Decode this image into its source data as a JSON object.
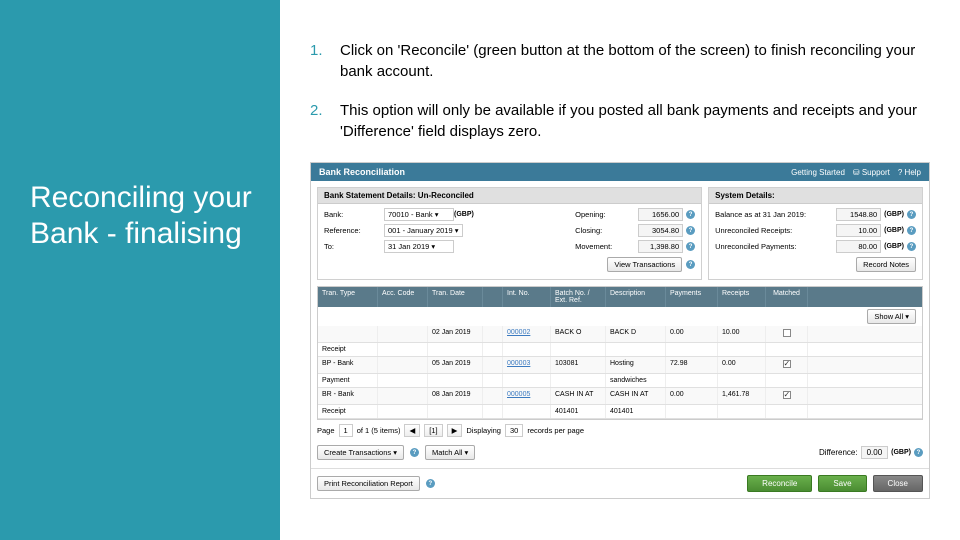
{
  "sidebar_title": "Reconciling your Bank - finalising",
  "steps": [
    "Click on 'Reconcile' (green button at the bottom of the screen) to finish reconciling your bank account.",
    "This option will only be available if you posted all bank payments and receipts and your 'Difference' field displays zero."
  ],
  "app": {
    "header": {
      "title": "Bank Reconciliation",
      "links": [
        "Getting Started",
        "Support",
        "Help"
      ]
    },
    "left_panel": {
      "heading": "Bank Statement Details: Un-Reconciled",
      "bank_label": "Bank:",
      "bank_value": "70010 - Bank",
      "bank_ccy": "(GBP)",
      "opening_label": "Opening:",
      "opening_value": "1656.00",
      "ref_label": "Reference:",
      "ref_value": "001 - January 2019",
      "closing_label": "Closing:",
      "closing_value": "3054.80",
      "to_label": "To:",
      "to_value": "31 Jan 2019",
      "movement_label": "Movement:",
      "movement_value": "1,398.80",
      "view_trans": "View Transactions"
    },
    "right_panel": {
      "heading": "System Details:",
      "balance_label": "Balance as at 31 Jan 2019:",
      "balance_value": "1548.80",
      "unrec_rec_label": "Unreconciled Receipts:",
      "unrec_rec_value": "10.00",
      "unrec_pay_label": "Unreconciled Payments:",
      "unrec_pay_value": "80.00",
      "record_notes": "Record Notes"
    },
    "grid": {
      "headers": [
        "Tran. Type",
        "Acc. Code",
        "Tran. Date",
        "",
        "Int. No.",
        "Batch No. / Ext. Ref.",
        "Description",
        "Payments",
        "Receipts",
        "Matched"
      ],
      "show_all": "Show All",
      "rows": [
        {
          "type": "",
          "code": "",
          "date": "02 Jan 2019",
          "int": "000002",
          "ext": "BACK O",
          "desc": "BACK D",
          "pay": "0.00",
          "rec": "10.00",
          "matched": false
        },
        {
          "type": "Receipt",
          "code": "",
          "date": "",
          "int": "",
          "ext": "",
          "desc": "",
          "pay": "",
          "rec": "",
          "matched": true
        },
        {
          "type": "BP - Bank",
          "code": "",
          "date": "05 Jan 2019",
          "int": "000003",
          "ext": "103081",
          "desc": "Hosting",
          "pay": "72.98",
          "rec": "0.00",
          "matched": true
        },
        {
          "type": "Payment",
          "code": "",
          "date": "",
          "int": "",
          "ext": "",
          "desc": "sandwiches",
          "pay": "",
          "rec": "",
          "matched": false
        },
        {
          "type": "BR - Bank",
          "code": "",
          "date": "08 Jan 2019",
          "int": "000005",
          "ext": "CASH IN AT",
          "desc": "CASH IN AT",
          "pay": "0.00",
          "rec": "1,461.78",
          "matched": true
        },
        {
          "type": "Receipt",
          "code": "",
          "date": "",
          "int": "",
          "ext": "401401",
          "desc": "401401",
          "pay": "",
          "rec": "",
          "matched": false
        }
      ]
    },
    "pager": {
      "page_label": "Page",
      "page": "1",
      "of": "of 1 (5 items)",
      "displaying": "Displaying",
      "per_page": "30",
      "per_page_label": "records per page"
    },
    "actions": {
      "create_trans": "Create Transactions",
      "match_all": "Match All",
      "difference_label": "Difference:",
      "difference_value": "0.00"
    },
    "footer": {
      "print": "Print Reconciliation Report",
      "reconcile": "Reconcile",
      "save": "Save",
      "close": "Close"
    }
  }
}
